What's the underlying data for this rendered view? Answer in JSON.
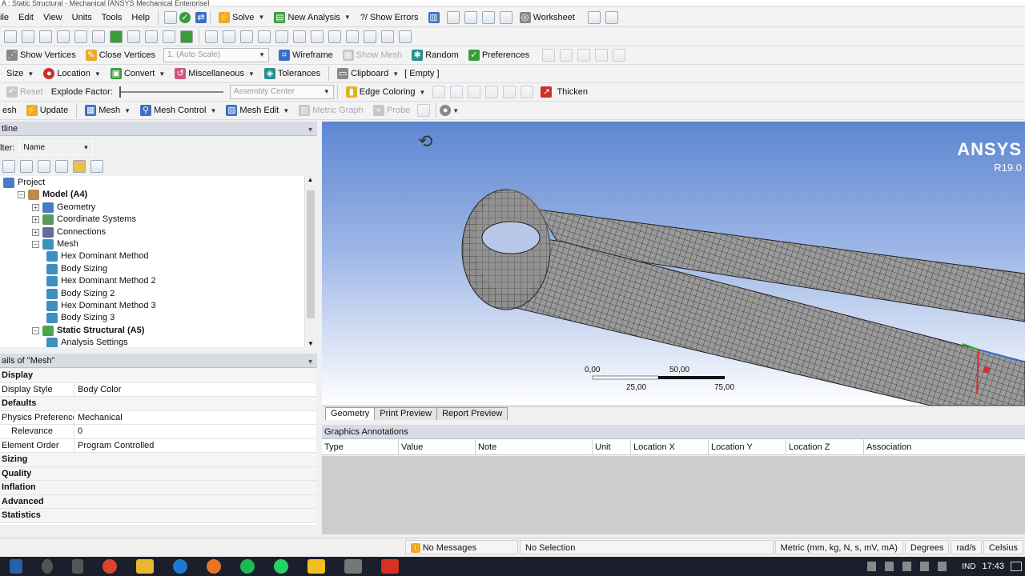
{
  "window": {
    "title": "A : Static Structural - Mechanical [ANSYS Mechanical Enterprise]"
  },
  "menu": {
    "items": [
      "File",
      "Edit",
      "View",
      "Units",
      "Tools",
      "Help"
    ],
    "solve": "Solve",
    "new_analysis": "New Analysis",
    "show_errors": "?/ Show Errors",
    "worksheet": "Worksheet"
  },
  "toolbar3": {
    "show_vertices": "Show Vertices",
    "close_vertices": "Close Vertices",
    "auto_scale": "1, (Auto Scale)",
    "wireframe": "Wireframe",
    "show_mesh": "Show Mesh",
    "random": "Random",
    "preferences": "Preferences"
  },
  "toolbar4": {
    "size": "Size",
    "location": "Location",
    "convert": "Convert",
    "miscellaneous": "Miscellaneous",
    "tolerances": "Tolerances",
    "clipboard": "Clipboard",
    "clipboard_value": "[ Empty ]"
  },
  "toolbar5": {
    "reset": "Reset",
    "explode_factor": "Explode Factor:",
    "assembly_center": "Assembly Center",
    "edge_coloring": "Edge Coloring",
    "thicken": "Thicken"
  },
  "toolbar6": {
    "mesh": "esh",
    "update": "Update",
    "mesh_btn": "Mesh",
    "mesh_control": "Mesh Control",
    "mesh_edit": "Mesh Edit",
    "metric_graph": "Metric Graph",
    "probe": "Probe"
  },
  "outline": {
    "header": "tline",
    "filter_label": "lter:",
    "filter_value": "Name",
    "tree": [
      {
        "label": "Project",
        "indent": 0,
        "icon": "project"
      },
      {
        "label": "Model (A4)",
        "indent": 1,
        "icon": "model",
        "bold": true
      },
      {
        "label": "Geometry",
        "indent": 2,
        "icon": "geom"
      },
      {
        "label": "Coordinate Systems",
        "indent": 2,
        "icon": "coord"
      },
      {
        "label": "Connections",
        "indent": 2,
        "icon": "conn"
      },
      {
        "label": "Mesh",
        "indent": 2,
        "icon": "mesh"
      },
      {
        "label": "Hex Dominant Method",
        "indent": 3,
        "icon": "mesh"
      },
      {
        "label": "Body Sizing",
        "indent": 3,
        "icon": "mesh"
      },
      {
        "label": "Hex Dominant Method 2",
        "indent": 3,
        "icon": "mesh"
      },
      {
        "label": "Body Sizing 2",
        "indent": 3,
        "icon": "mesh"
      },
      {
        "label": "Hex Dominant Method 3",
        "indent": 3,
        "icon": "mesh"
      },
      {
        "label": "Body Sizing 3",
        "indent": 3,
        "icon": "mesh"
      },
      {
        "label": "Static Structural (A5)",
        "indent": 2,
        "icon": "ss",
        "bold": true
      },
      {
        "label": "Analysis Settings",
        "indent": 3,
        "icon": "mesh"
      }
    ]
  },
  "details": {
    "header": "ails of \"Mesh\"",
    "rows": [
      {
        "key": "Display",
        "value": "",
        "cat": true
      },
      {
        "key": "Display Style",
        "value": "Body Color"
      },
      {
        "key": "Defaults",
        "value": "",
        "cat": true
      },
      {
        "key": "Physics Preference",
        "value": "Mechanical"
      },
      {
        "key": "Relevance",
        "value": "0"
      },
      {
        "key": "Element Order",
        "value": "Program Controlled"
      },
      {
        "key": "Sizing",
        "value": "",
        "cat": true
      },
      {
        "key": "Quality",
        "value": "",
        "cat": true
      },
      {
        "key": "Inflation",
        "value": "",
        "cat": true
      },
      {
        "key": "Advanced",
        "value": "",
        "cat": true
      },
      {
        "key": "Statistics",
        "value": "",
        "cat": true
      }
    ]
  },
  "viewport": {
    "logo": "ANSYS",
    "version": "R19.0",
    "scale_top": [
      "0,00",
      "50,00"
    ],
    "scale_bottom": [
      "25,00",
      "75,00"
    ]
  },
  "tabs": [
    "Geometry",
    "Print Preview",
    "Report Preview"
  ],
  "annotations": {
    "header": "Graphics Annotations",
    "columns": [
      "Type",
      "Value",
      "Note",
      "Unit",
      "Location X",
      "Location Y",
      "Location Z",
      "Association"
    ]
  },
  "status": {
    "messages": "No Messages",
    "selection": "No Selection",
    "units": "Metric (mm, kg, N, s, mV, mA)",
    "angle": "Degrees",
    "rate": "rad/s",
    "temp": "Celsius"
  },
  "taskbar": {
    "time": "17:43",
    "lang": "IND"
  }
}
